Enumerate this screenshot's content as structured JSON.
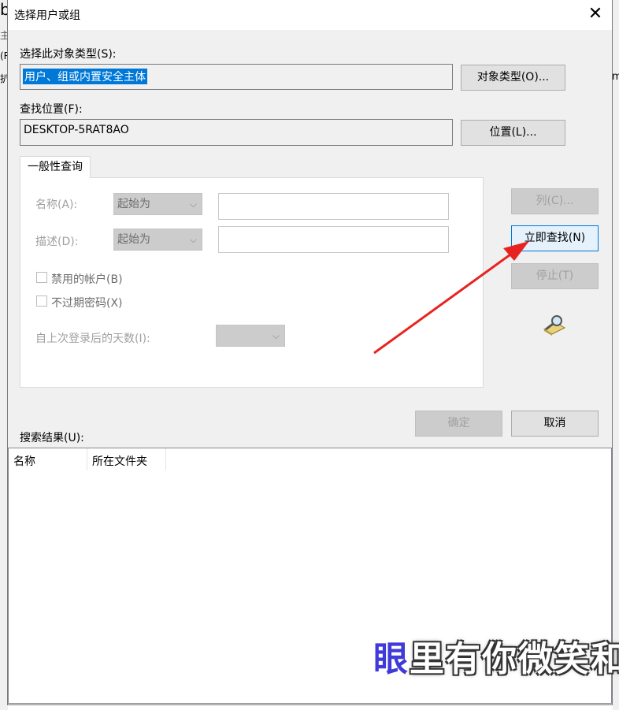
{
  "background": {
    "left_fragments": [
      "b",
      "主",
      "(R",
      "扒"
    ],
    "right_fragment": "m"
  },
  "dialog": {
    "title": "选择用户或组",
    "close_glyph": "✕",
    "object_type": {
      "label": "选择此对象类型(S):",
      "value": "用户、组或内置安全主体",
      "button": "对象类型(O)..."
    },
    "location": {
      "label": "查找位置(F):",
      "value": "DESKTOP-5RAT8AO",
      "button": "位置(L)..."
    },
    "tab": "一般性查询",
    "query": {
      "name_label": "名称(A):",
      "name_mode": "起始为",
      "desc_label": "描述(D):",
      "desc_mode": "起始为",
      "disabled_accounts": "禁用的帐户(B)",
      "non_expiring_pw": "不过期密码(X)",
      "days_label": "自上次登录后的天数(I):"
    },
    "side_buttons": {
      "columns": "列(C)...",
      "find_now": "立即查找(N)",
      "stop": "停止(T)"
    },
    "ok": "确定",
    "cancel": "取消",
    "results_label": "搜索结果(U):",
    "results_columns": [
      "名称",
      "所在文件夹"
    ]
  },
  "watermark": {
    "first_char": "眼",
    "rest": "里有你微笑和"
  },
  "colors": {
    "accent": "#0078d7",
    "arrow": "#e8231f",
    "dialog_bg": "#f0f0f0"
  },
  "icons": {
    "search_animation": "magnifier-over-folder-icon",
    "chevron": "chevron-down-icon"
  }
}
